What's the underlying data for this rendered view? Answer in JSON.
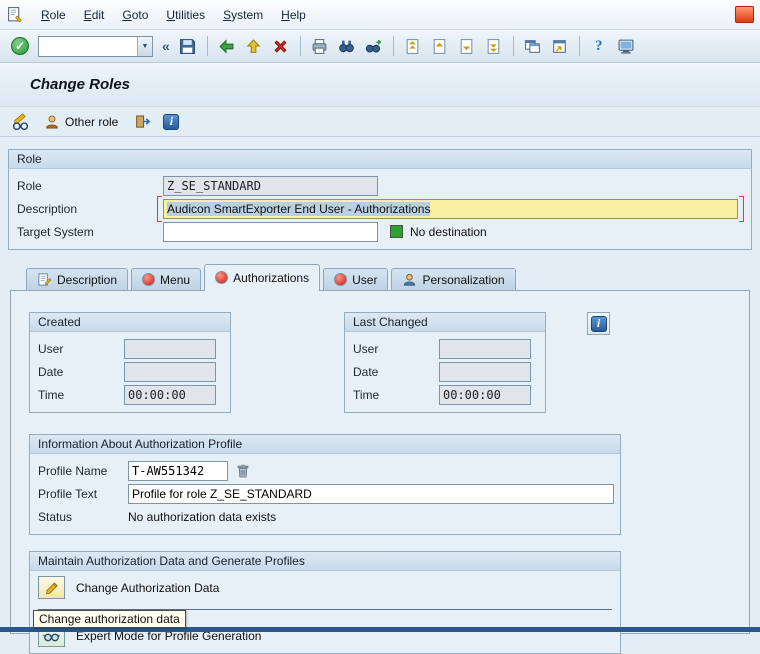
{
  "window": {
    "title": "Change Roles"
  },
  "icons": {
    "continue_check": "✓",
    "collapse_chevrons": "«",
    "dropdown_arrow": "▼",
    "help_question": "?",
    "info_i": "i"
  },
  "menubar": {
    "items": [
      {
        "label": "Role"
      },
      {
        "label": "Edit"
      },
      {
        "label": "Goto"
      },
      {
        "label": "Utilities"
      },
      {
        "label": "System"
      },
      {
        "label": "Help"
      }
    ]
  },
  "toolbar": {
    "command_value": ""
  },
  "app_toolbar": {
    "other_role_label": "Other role"
  },
  "role_box": {
    "header": "Role",
    "role_label": "Role",
    "role_value": "Z_SE_STANDARD",
    "description_label": "Description",
    "description_value": "Audicon SmartExporter End User - Authorizations",
    "target_system_label": "Target System",
    "target_system_value": "",
    "no_destination_text": "No destination"
  },
  "tabs": [
    {
      "label": "Description"
    },
    {
      "label": "Menu"
    },
    {
      "label": "Authorizations"
    },
    {
      "label": "User"
    },
    {
      "label": "Personalization"
    }
  ],
  "created_box": {
    "header": "Created",
    "user_label": "User",
    "user_value": "",
    "date_label": "Date",
    "date_value": "",
    "time_label": "Time",
    "time_value": "00:00:00"
  },
  "last_changed_box": {
    "header": "Last Changed",
    "user_label": "User",
    "user_value": "",
    "date_label": "Date",
    "date_value": "",
    "time_label": "Time",
    "time_value": "00:00:00"
  },
  "profile_box": {
    "header": "Information About Authorization Profile",
    "profile_name_label": "Profile Name",
    "profile_name_value": "T-AW551342",
    "profile_text_label": "Profile Text",
    "profile_text_value": "Profile for role Z_SE_STANDARD",
    "status_label": "Status",
    "status_value": "No authorization data exists"
  },
  "maintain_box": {
    "header": "Maintain Authorization Data and Generate Profiles",
    "change_auth_label": "Change Authorization Data",
    "tooltip_text": "Change authorization data",
    "expert_mode_label": "Expert Mode for Profile Generation"
  }
}
